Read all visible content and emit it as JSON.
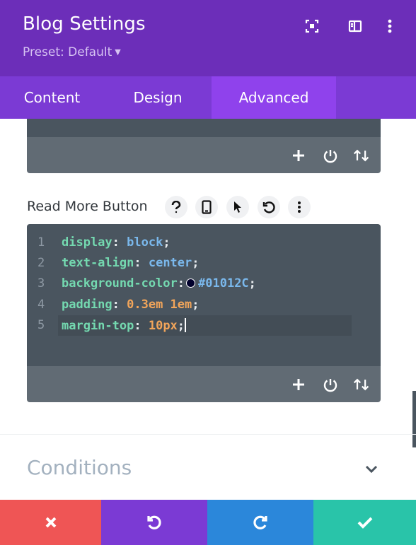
{
  "header": {
    "title": "Blog Settings",
    "preset_label": "Preset: Default",
    "icons": [
      "screenshot-focus-icon",
      "sidebar-layout-icon",
      "more-vertical-icon"
    ]
  },
  "tabs": [
    {
      "label": "Content",
      "active": false
    },
    {
      "label": "Design",
      "active": false
    },
    {
      "label": "Advanced",
      "active": true
    }
  ],
  "field": {
    "label": "Read More Button",
    "icons": [
      "help-icon",
      "mobile-icon",
      "cursor-hover-icon",
      "reset-icon",
      "more-icon"
    ]
  },
  "code_lines": [
    {
      "num": "1",
      "prop": "display",
      "value": "block"
    },
    {
      "num": "2",
      "prop": "text-align",
      "value": "center"
    },
    {
      "num": "3",
      "prop": "background-color",
      "value": "#01012C",
      "swatch": "#01012c"
    },
    {
      "num": "4",
      "prop": "padding",
      "value": "0.3em 1em"
    },
    {
      "num": "5",
      "prop": "margin-top",
      "value": "10px"
    }
  ],
  "sections": {
    "conditions_label": "Conditions"
  },
  "colors": {
    "header_bg": "#6c2eb9",
    "tabs_bg": "#7b3ad4",
    "active_tab_bg": "#8f42ec",
    "cancel": "#ef5555",
    "undo": "#7b3ad4",
    "redo": "#2b87da",
    "save": "#29c4a9"
  }
}
